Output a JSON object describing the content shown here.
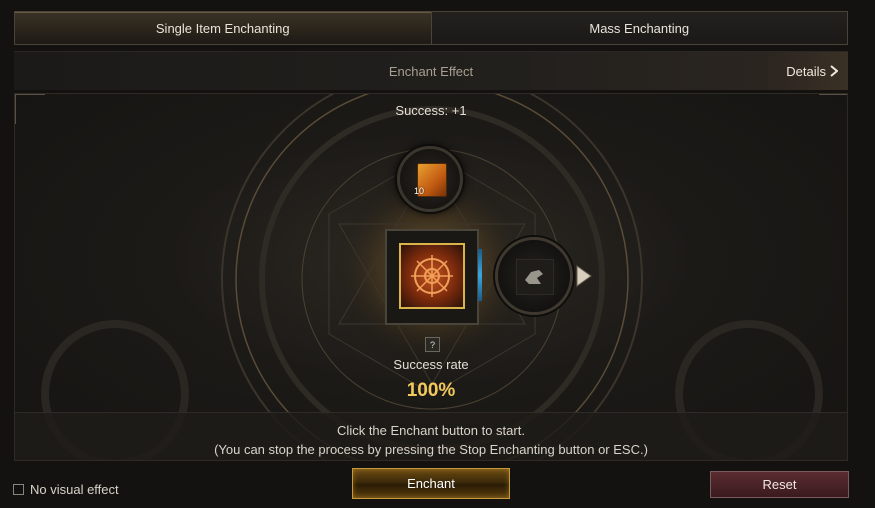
{
  "tabs": [
    {
      "label": "Single Item Enchanting",
      "active": true
    },
    {
      "label": "Mass Enchanting",
      "active": false
    }
  ],
  "effect_bar": {
    "title": "Enchant Effect",
    "details_label": "Details",
    "details_icon": "chevron-right-icon"
  },
  "stage": {
    "success_label": "Success: +1",
    "scroll_count": "10",
    "rate_label": "Success rate",
    "rate_value": "100%",
    "help_glyph": "?",
    "instruction_line1": "Click the Enchant button to start.",
    "instruction_line2": "(You can stop the process by pressing the Stop Enchanting button or ESC.)"
  },
  "footer": {
    "no_visual_effect_label": "No visual effect",
    "no_visual_effect_checked": false,
    "enchant_label": "Enchant",
    "reset_label": "Reset"
  },
  "colors": {
    "accent_gold": "#f2c95a",
    "enchant_border": "#c69a3a",
    "reset_bg": "#4a2226",
    "indicator_blue": "#3aa6e0"
  }
}
